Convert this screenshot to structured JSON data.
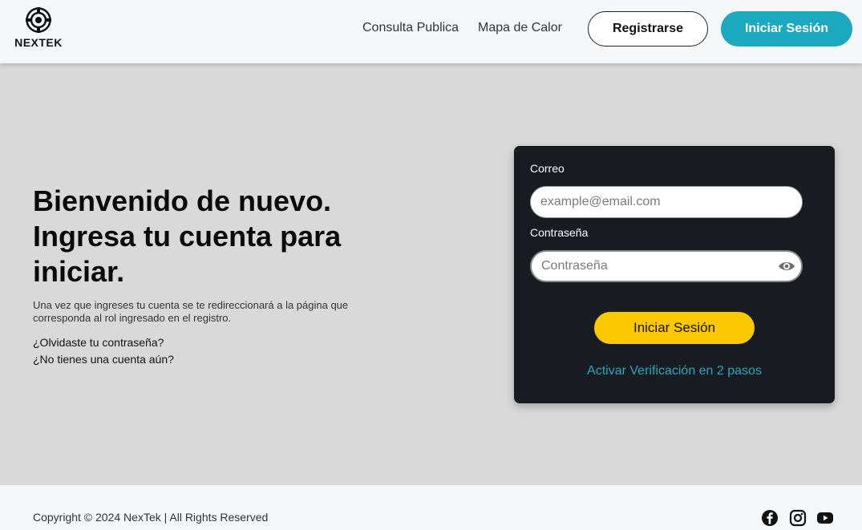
{
  "header": {
    "brand": "NEXTEK",
    "nav": {
      "consulta": "Consulta Publica",
      "mapa": "Mapa de Calor"
    },
    "register_label": "Registrarse",
    "login_label": "Iniciar Sesión"
  },
  "hero": {
    "title": "Bienvenido de nuevo. Ingresa tu cuenta para iniciar.",
    "description": "Una vez que ingreses tu cuenta se te redireccionará a la página que corresponda al rol ingresado en el registro.",
    "forgot_password": "¿Olvidaste tu contraseña?",
    "no_account": "¿No tienes una cuenta aún?"
  },
  "login_form": {
    "email_label": "Correo",
    "email_placeholder": "example@email.com",
    "email_value": "",
    "password_label": "Contraseña",
    "password_placeholder": "Contraseña",
    "password_value": "",
    "password_toggle_icon": "eye-icon",
    "submit_label": "Iniciar Sesión",
    "two_factor_link": "Activar Verificación en 2 pasos"
  },
  "footer": {
    "copyright": "Copyright © 2024 NexTek | All Rights Reserved",
    "social_icons": [
      "facebook-icon",
      "instagram-icon",
      "youtube-icon"
    ]
  },
  "colors": {
    "accent_teal": "#1ba9bf",
    "submit_yellow": "#fcc800",
    "card_bg": "#181c22",
    "page_bg": "#d9d9d9",
    "header_bg": "#f6f7f9"
  }
}
